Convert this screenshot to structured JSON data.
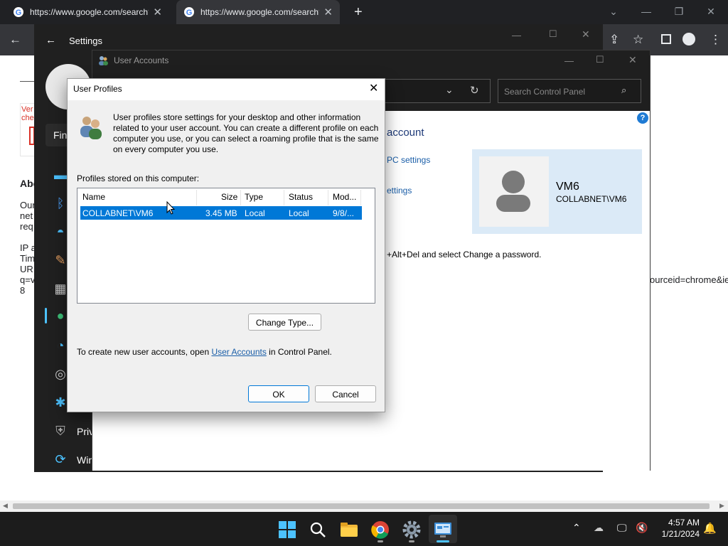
{
  "browser": {
    "tabs": [
      {
        "title": "https://www.google.com/search?"
      },
      {
        "title": "https://www.google.com/search?"
      }
    ],
    "page_fragments": {
      "ver": "Ver",
      "che": "che",
      "find": "Fin",
      "about": "Abo",
      "our": "Our",
      "net": "net",
      "req": "req",
      "ip": "IP a",
      "tim": "Tim",
      "url": "UR",
      "q": "q=v",
      "eight": "8",
      "sourceid": "ourceid=chrome&ie"
    }
  },
  "settings": {
    "title": "Settings",
    "nav_partial": {
      "privacy": "Priv",
      "windows_update": "Win"
    }
  },
  "user_accounts": {
    "title": "User Accounts",
    "search_placeholder": "Search Control Panel",
    "heading_partial": "account",
    "links": {
      "pc_settings": "PC settings",
      "settings": "ettings"
    },
    "password_hint": "+Alt+Del and select Change a password.",
    "user": {
      "name": "VM6",
      "account": "COLLABNET\\VM6"
    }
  },
  "dialog": {
    "title": "User Profiles",
    "description": "User profiles store settings for your desktop and other information related to your user account. You can create a different profile on each computer you use, or you can select a roaming profile that is the same on every computer you use.",
    "profiles_label": "Profiles stored on this computer:",
    "columns": [
      "Name",
      "Size",
      "Type",
      "Status",
      "Mod..."
    ],
    "rows": [
      {
        "name": "COLLABNET\\VM6",
        "size": "3.45 MB",
        "type": "Local",
        "status": "Local",
        "modified": "9/8/..."
      }
    ],
    "change_type_label": "Change Type...",
    "footer_prefix": "To create new user accounts, open ",
    "footer_link": "User Accounts",
    "footer_suffix": " in Control Panel.",
    "ok_label": "OK",
    "cancel_label": "Cancel"
  },
  "taskbar": {
    "time": "4:57 AM",
    "date": "1/21/2024"
  },
  "colors": {
    "selection": "#0078d7",
    "link": "#1a5ea8",
    "chrome_dark": "#202124",
    "taskbar": "#1c1c1c"
  }
}
